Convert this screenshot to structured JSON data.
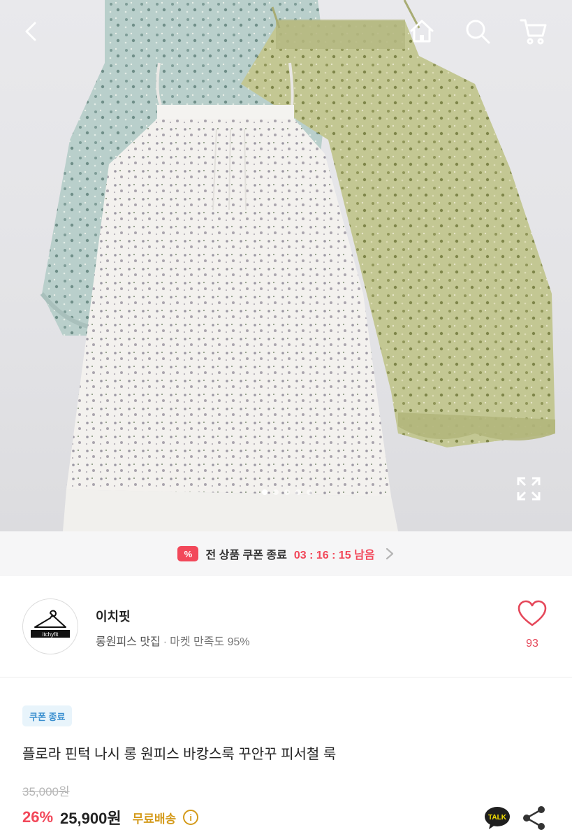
{
  "header": {
    "back_icon": "chevron-left-icon",
    "home_icon": "home-icon",
    "search_icon": "search-icon",
    "cart_icon": "cart-icon",
    "image_count_total": 5,
    "image_index": 1
  },
  "coupon_bar": {
    "badge": "%",
    "label": "전 상품 쿠폰 종료",
    "timer": "03 : 16 : 15 남음"
  },
  "shop": {
    "name": "이치핏",
    "logo_text": "itchyfit",
    "tagline": "롱원피스 맛집",
    "separator": "·",
    "satisfaction": "마켓 만족도 95%",
    "like_count": "93"
  },
  "product": {
    "tag": "쿠폰 종료",
    "title": "플로라 핀턱 나시 롱 원피스 바캉스룩 꾸안꾸 피서철 룩",
    "original_price": "35,000원",
    "discount": "26%",
    "price": "25,900원",
    "free_shipping": "무료배송",
    "info_icon": "i",
    "talk_label": "TALK"
  },
  "colors": {
    "accent": "#f2485a",
    "shipping": "#d49a1a",
    "tag_bg": "#e8f4fb",
    "tag_text": "#3a8fcf"
  }
}
